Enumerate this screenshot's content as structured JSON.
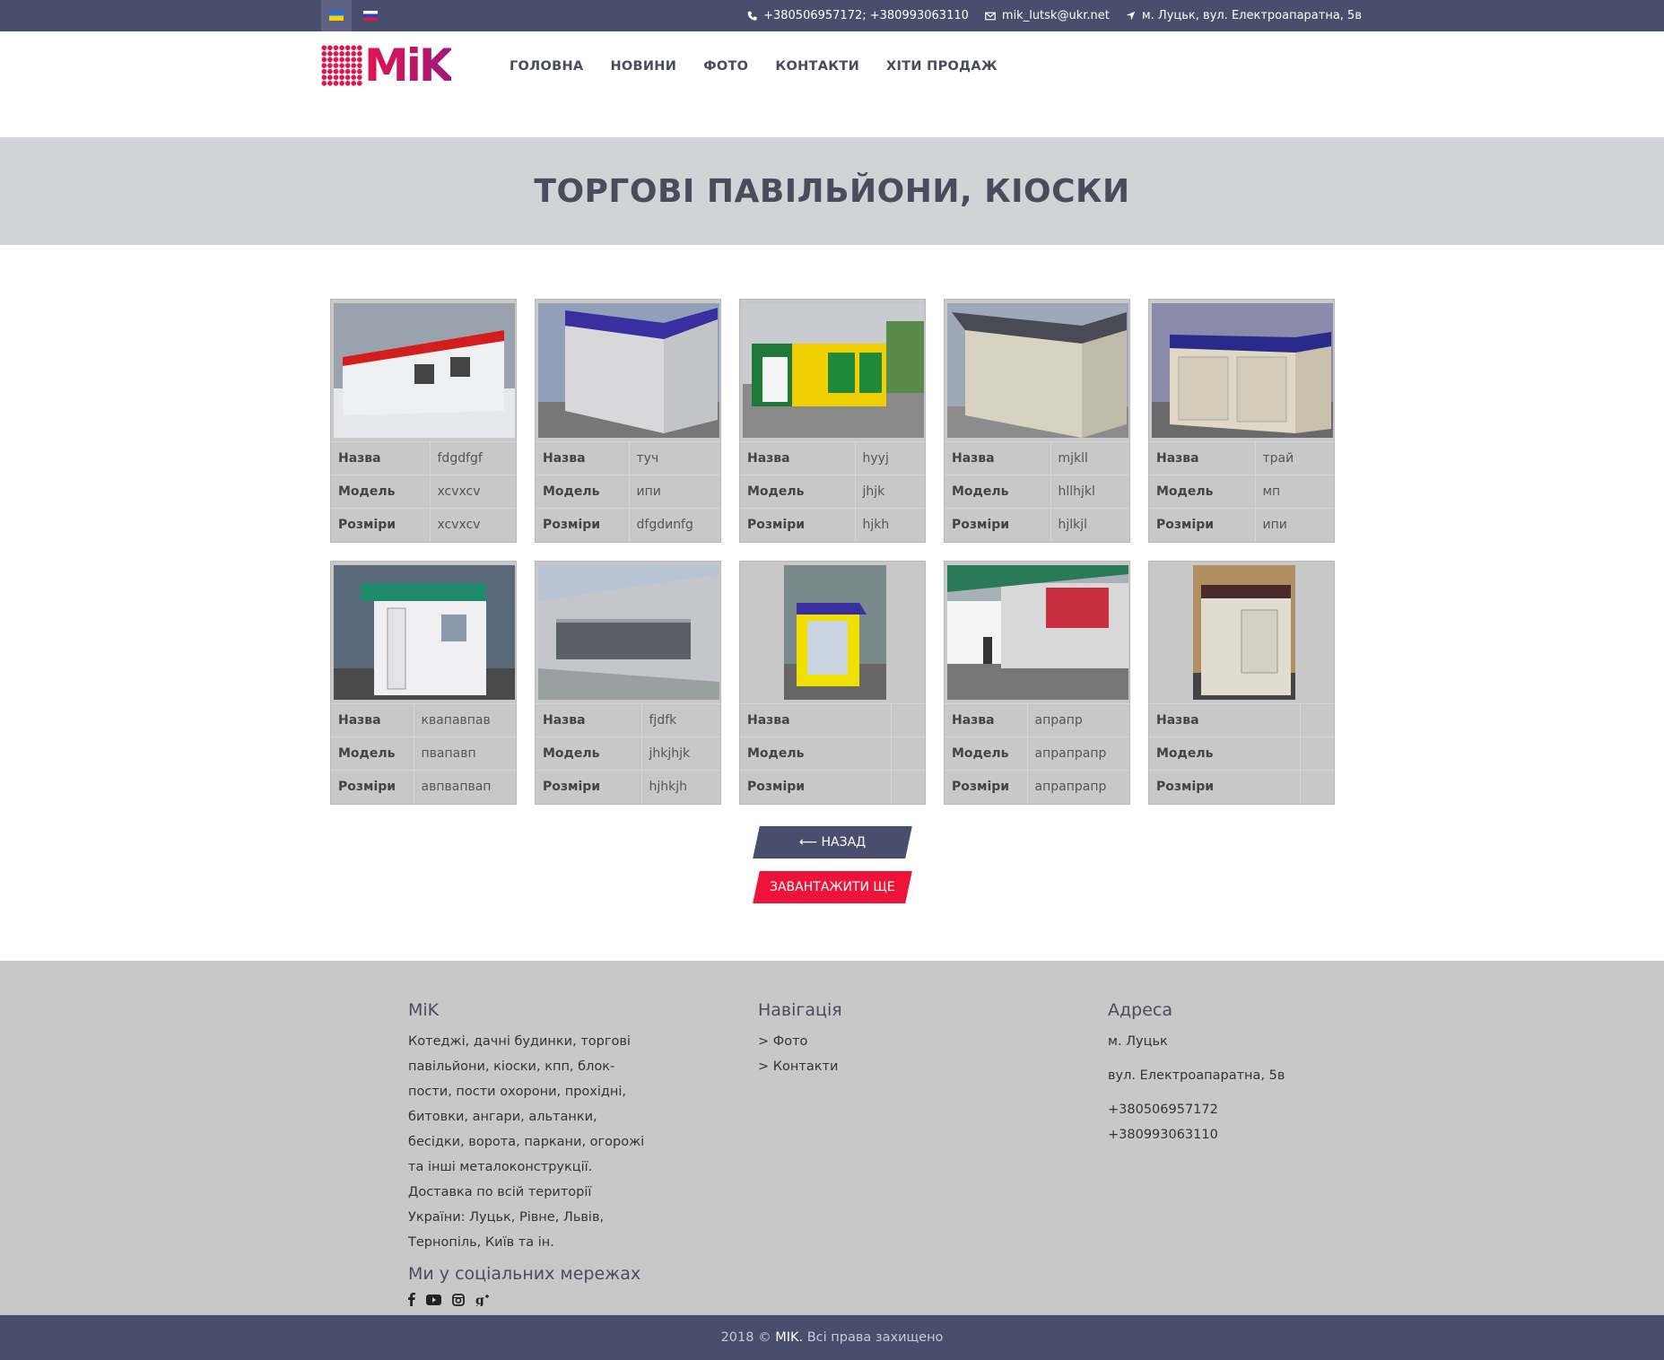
{
  "topbar": {
    "langs": [
      {
        "name": "ukrainian-flag"
      },
      {
        "name": "russian-flag"
      }
    ],
    "phones": "+380506957172; +380993063110",
    "email": "mik_lutsk@ukr.net",
    "address": "м. Луцьк, вул. Електроапаратна, 5в"
  },
  "logo": {
    "text": "MiK"
  },
  "nav": [
    "ГОЛОВНА",
    "НОВИНИ",
    "ФОТО",
    "КОНТАКТИ",
    "ХІТИ ПРОДАЖ"
  ],
  "banner": {
    "title": "ТОРГОВІ ПАВІЛЬЙОНИ, КІОСКИ"
  },
  "labels": {
    "name": "Назва",
    "model": "Модель",
    "size": "Розміри"
  },
  "products": [
    {
      "name": "fdgdfgf",
      "model": "xcvxcv",
      "size": "xcvxcv"
    },
    {
      "name": "туч",
      "model": "ипи",
      "size": "dfgdиnfg"
    },
    {
      "name": "hyyj",
      "model": "jhjk",
      "size": "hjkh"
    },
    {
      "name": "mjkll",
      "model": "hllhjkl",
      "size": "hjlkjl"
    },
    {
      "name": "трай",
      "model": "мп",
      "size": "ипи"
    },
    {
      "name": "квапавпав",
      "model": "пвапавп",
      "size": "авпвапвап"
    },
    {
      "name": "fjdfk",
      "model": "jhkjhjk",
      "size": "hjhkjh"
    },
    {
      "name": "",
      "model": "",
      "size": ""
    },
    {
      "name": "апрапр",
      "model": "апрапрапр",
      "size": "апрапрапр"
    },
    {
      "name": "",
      "model": "",
      "size": ""
    }
  ],
  "buttons": {
    "back": "⟵ НАЗАД",
    "more": "ЗАВАНТАЖИТИ ЩЕ"
  },
  "footer": {
    "about_title": "MiK",
    "about_text": "Котеджі, дачні будинки, торгові павільйони, кіоски, кпп, блок-пости, пости охорони, прохідні, битовки, ангари, альтанки, бесідки, ворота, паркани, огорожі та інші металоконструкції. Доставка по всій території України: Луцьк, Рівне, Львів, Тернопіль, Київ та ін.",
    "social_title": "Ми у соціальних мережах",
    "social_icons": [
      "facebook-icon",
      "youtube-icon",
      "instagram-icon",
      "google-plus-icon"
    ],
    "nav_title": "Навігація",
    "nav_links": [
      "> Фото",
      "> Контакти"
    ],
    "address_title": "Адреса",
    "city": "м. Луцьк",
    "street": "вул. Електроапаратна, 5в",
    "phone1": "+380506957172",
    "phone2": "+380993063110"
  },
  "copyright": {
    "year": "2018 ©",
    "brand": "MIK.",
    "rights": "Всі права захищено"
  }
}
